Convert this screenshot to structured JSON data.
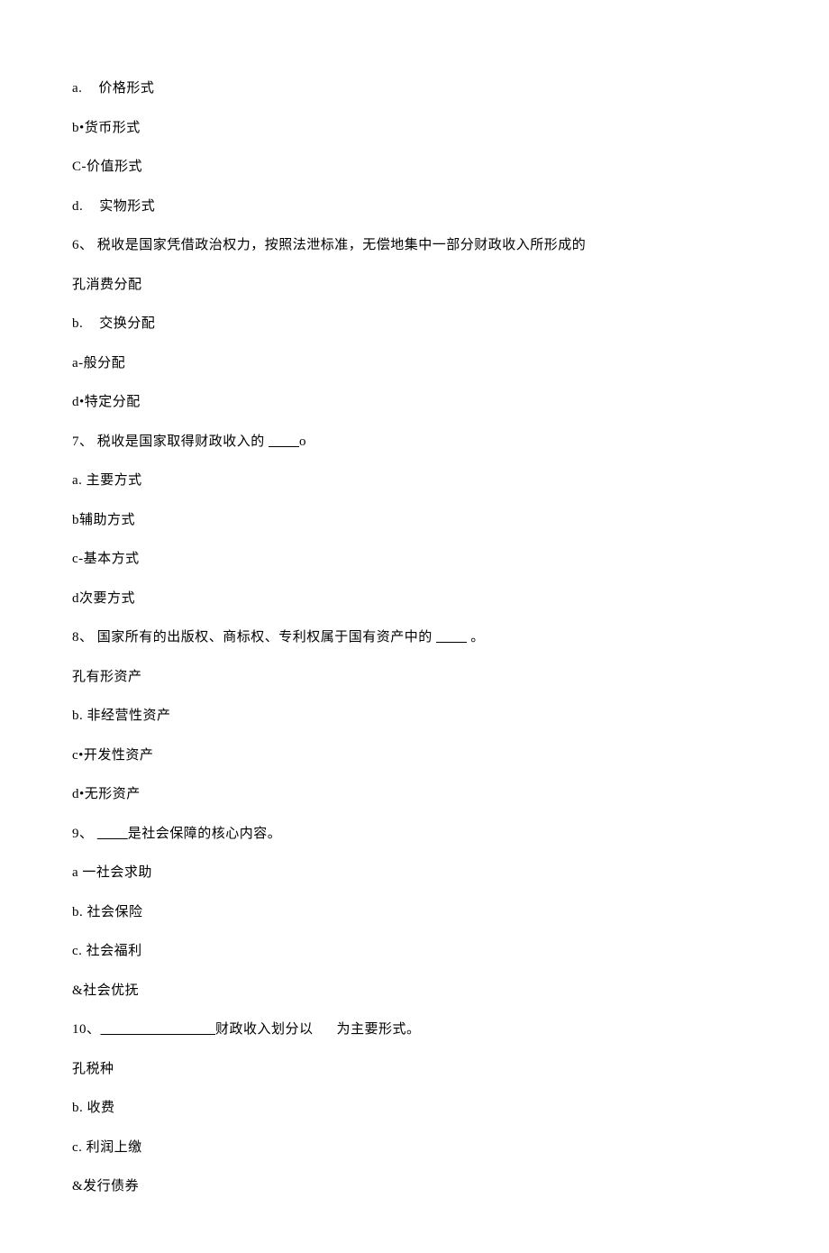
{
  "lines": [
    {
      "name": "q5-opt-a",
      "segments": [
        {
          "t": "a."
        },
        {
          "gap": "opt-gap"
        },
        {
          "t": "价格形式"
        }
      ]
    },
    {
      "name": "q5-opt-b",
      "segments": [
        {
          "t": "b•货币形式"
        }
      ]
    },
    {
      "name": "q5-opt-c",
      "segments": [
        {
          "t": "C-价值形式"
        }
      ]
    },
    {
      "name": "q5-opt-d",
      "segments": [
        {
          "t": "d."
        },
        {
          "gap": "opt-gap"
        },
        {
          "t": "实物形式"
        }
      ]
    },
    {
      "name": "q6-stem",
      "segments": [
        {
          "t": "6、 税收是国家凭借政治权力，按照法泄标准，无偿地集中一部分财政收入所形成的"
        }
      ]
    },
    {
      "name": "q6-opt-a",
      "segments": [
        {
          "t": "孔消费分配"
        }
      ]
    },
    {
      "name": "q6-opt-b",
      "segments": [
        {
          "t": "b."
        },
        {
          "gap": "opt-gap"
        },
        {
          "t": "交换分配"
        }
      ]
    },
    {
      "name": "q6-opt-c",
      "segments": [
        {
          "t": "a-般分配"
        }
      ]
    },
    {
      "name": "q6-opt-d",
      "segments": [
        {
          "t": "d•特定分配"
        }
      ]
    },
    {
      "name": "q7-stem",
      "segments": [
        {
          "t": "7、 税收是国家取得财政收入的 "
        },
        {
          "blank": "        "
        },
        {
          "t": "o"
        }
      ]
    },
    {
      "name": "q7-opt-a",
      "segments": [
        {
          "t": "a. 主要方式"
        }
      ]
    },
    {
      "name": "q7-opt-b",
      "segments": [
        {
          "t": "b辅助方式"
        }
      ]
    },
    {
      "name": "q7-opt-c",
      "segments": [
        {
          "t": "c-基本方式"
        }
      ]
    },
    {
      "name": "q7-opt-d",
      "segments": [
        {
          "t": "d次要方式"
        }
      ]
    },
    {
      "name": "q8-stem",
      "segments": [
        {
          "t": "8、 国家所有的出版权、商标权、专利权属于国有资产中的  "
        },
        {
          "blank": "        "
        },
        {
          "t": " 。"
        }
      ]
    },
    {
      "name": "q8-opt-a",
      "segments": [
        {
          "t": "孔有形资产"
        }
      ]
    },
    {
      "name": "q8-opt-b",
      "segments": [
        {
          "t": "b. 非经营性资产"
        }
      ]
    },
    {
      "name": "q8-opt-c",
      "segments": [
        {
          "t": "c•开发性资产"
        }
      ]
    },
    {
      "name": "q8-opt-d",
      "segments": [
        {
          "t": "d•无形资产"
        }
      ]
    },
    {
      "name": "q9-stem",
      "segments": [
        {
          "t": "9、 "
        },
        {
          "blank": "        "
        },
        {
          "t": "是社会保障的核心内容。"
        }
      ]
    },
    {
      "name": "q9-opt-a",
      "segments": [
        {
          "t": "a  一社会求助"
        }
      ]
    },
    {
      "name": "q9-opt-b",
      "segments": [
        {
          "t": "b. 社会保险"
        }
      ]
    },
    {
      "name": "q9-opt-c",
      "segments": [
        {
          "t": "c. 社会福利"
        }
      ]
    },
    {
      "name": "q9-opt-d",
      "segments": [
        {
          "t": "&社会优抚"
        }
      ]
    },
    {
      "name": "q10-stem",
      "segments": [
        {
          "t": "10、"
        },
        {
          "blank": "                              "
        },
        {
          "t": "财政收入划分以"
        },
        {
          "gap": "mid-gap"
        },
        {
          "t": "为主要形式。"
        }
      ]
    },
    {
      "name": "q10-opt-a",
      "segments": [
        {
          "t": "孔税种"
        }
      ]
    },
    {
      "name": "q10-opt-b",
      "segments": [
        {
          "t": "b. 收费"
        }
      ]
    },
    {
      "name": "q10-opt-c",
      "segments": [
        {
          "t": "c. 利润上缴"
        }
      ]
    },
    {
      "name": "q10-opt-d",
      "segments": [
        {
          "t": "&发行债券"
        }
      ]
    }
  ]
}
